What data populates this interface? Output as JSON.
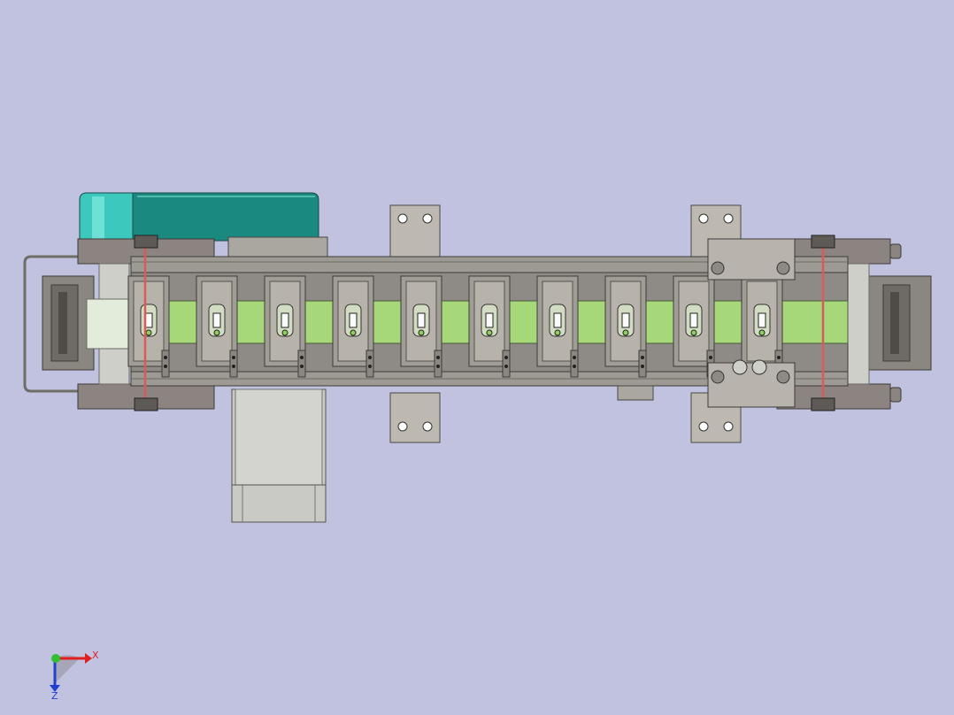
{
  "view": {
    "background": "#c0c2e0",
    "triad": {
      "x_label": "X",
      "z_label": "Z"
    }
  },
  "model": {
    "colors": {
      "frame": "#9d9a93",
      "frame_dark": "#7d7a74",
      "side_plate": "#8b8480",
      "motor_cover": "#1a8a80",
      "motor_cover_light": "#3cc8bc",
      "belt": "#a6d87a",
      "belt_cable": "#d85a5a",
      "motor_body": "#c9c9c6",
      "shaft": "#cfcfca"
    },
    "carrier_count": 10
  }
}
